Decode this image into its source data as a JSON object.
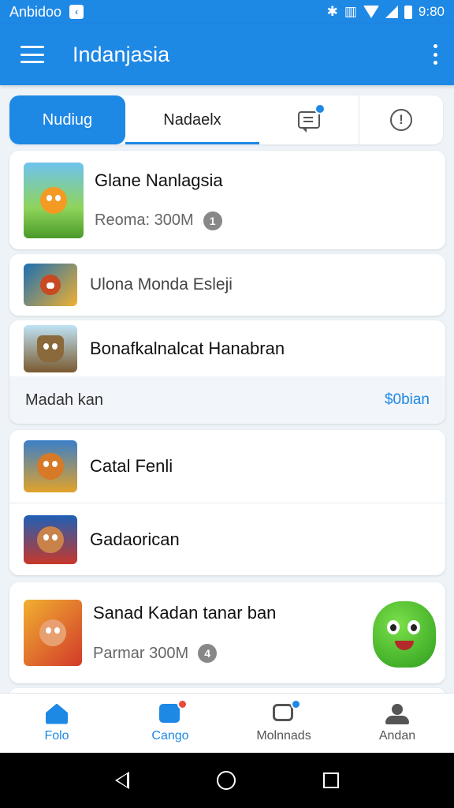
{
  "status_bar": {
    "carrier": "Anbidoo",
    "time": "9:80"
  },
  "app_bar": {
    "title": "Indanjasia",
    "menu_icon": "hamburger-icon",
    "more_icon": "more-vert-icon"
  },
  "tabs": [
    {
      "label": "Nudiug",
      "active": true
    },
    {
      "label": "Nadaelx",
      "active": false
    },
    {
      "label": "",
      "icon": "chat-icon",
      "badge_color": "#1e88e5"
    },
    {
      "label": "",
      "icon": "alert-icon"
    }
  ],
  "games": {
    "card1": {
      "title": "Glane Nanlagsia",
      "subtitle": "Reoma: 300M",
      "badge": "1"
    },
    "card2": {
      "title": "Ulona Monda Esleji"
    },
    "card3": {
      "title": "Bonafkalnalcat Hanabran",
      "footer_text": "Madah kan",
      "footer_link": "$0bian"
    },
    "card4": {
      "title": "Catal Fenli"
    },
    "card5": {
      "title": "Gadaorican"
    },
    "card6": {
      "title": "Sanad Kadan tanar ban",
      "subtitle": "Parmar 300M",
      "badge": "4"
    }
  },
  "bottom_nav": [
    {
      "label": "Folo",
      "icon": "home-icon",
      "active": true
    },
    {
      "label": "Cango",
      "icon": "game-icon",
      "active": true,
      "badge_color": "#e74c3c"
    },
    {
      "label": "Molnnads",
      "icon": "chat-icon",
      "active": false,
      "badge_color": "#1e88e5"
    },
    {
      "label": "Andan",
      "icon": "person-icon",
      "active": false
    }
  ],
  "colors": {
    "primary": "#1e88e5",
    "background": "#eef3f8"
  }
}
